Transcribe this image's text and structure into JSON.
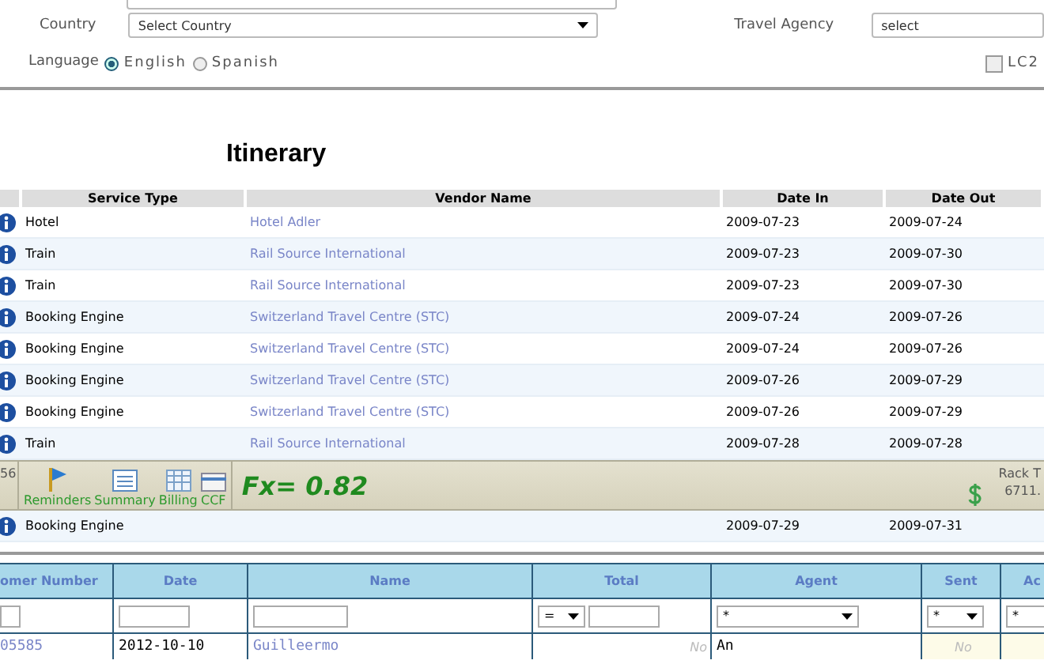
{
  "filters": {
    "country": {
      "label": "Country",
      "value": "Select Country"
    },
    "travel_agency": {
      "label": "Travel Agency",
      "value": "select"
    },
    "language": {
      "label": "Language",
      "options": [
        {
          "label": "English",
          "selected": true
        },
        {
          "label": "Spanish",
          "selected": false
        }
      ]
    },
    "lc2": {
      "label": "LC2",
      "checked": false
    }
  },
  "itinerary": {
    "title": "Itinerary",
    "columns": [
      "Service Type",
      "Vendor Name",
      "Date In",
      "Date Out"
    ],
    "rows": [
      {
        "service": "Hotel",
        "vendor": "Hotel Adler",
        "date_in": "2009-07-23",
        "date_out": "2009-07-24"
      },
      {
        "service": "Train",
        "vendor": "Rail Source International",
        "date_in": "2009-07-23",
        "date_out": "2009-07-30"
      },
      {
        "service": "Train",
        "vendor": "Rail Source International",
        "date_in": "2009-07-23",
        "date_out": "2009-07-30"
      },
      {
        "service": "Booking Engine",
        "vendor": "Switzerland Travel Centre (STC)",
        "date_in": "2009-07-24",
        "date_out": "2009-07-26"
      },
      {
        "service": "Booking Engine",
        "vendor": "Switzerland Travel Centre (STC)",
        "date_in": "2009-07-24",
        "date_out": "2009-07-26"
      },
      {
        "service": "Booking Engine",
        "vendor": "Switzerland Travel Centre (STC)",
        "date_in": "2009-07-26",
        "date_out": "2009-07-29"
      },
      {
        "service": "Booking Engine",
        "vendor": "Switzerland Travel Centre (STC)",
        "date_in": "2009-07-26",
        "date_out": "2009-07-29"
      },
      {
        "service": "Train",
        "vendor": "Rail Source International",
        "date_in": "2009-07-28",
        "date_out": "2009-07-28"
      }
    ],
    "after_toolbar": [
      {
        "service": "Booking Engine",
        "date_in": "2009-07-29",
        "date_out": "2009-07-31"
      }
    ]
  },
  "toolbar": {
    "left_fragment": "56",
    "buttons": [
      {
        "kind": "flag",
        "label": "Reminders"
      },
      {
        "kind": "list",
        "label": "Summary"
      },
      {
        "kind": "grid",
        "label": "Billing"
      },
      {
        "kind": "card",
        "label": "CCF"
      }
    ],
    "fx": "Fx= 0.82",
    "rack_label": "Rack T",
    "rack_value": "6711."
  },
  "grid": {
    "columns": [
      "omer Number",
      "Date",
      "Name",
      "Total",
      "Agent",
      "Sent",
      "Ac"
    ],
    "filters": {
      "total_operator": "=",
      "agent": "*",
      "sent": "*",
      "ac": "*"
    },
    "rows": [
      {
        "number": "05585",
        "date": "2012-10-10",
        "name": "Guilleermo",
        "total": "No",
        "agent": "An",
        "sent": "No"
      }
    ]
  }
}
